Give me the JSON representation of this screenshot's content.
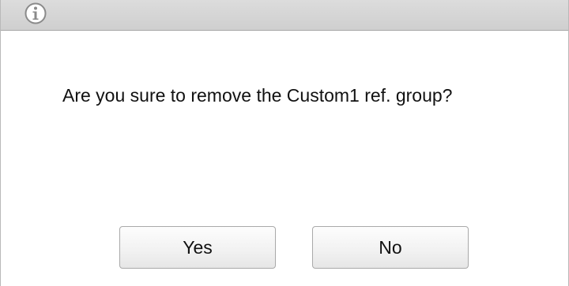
{
  "dialog": {
    "icon": "info-icon",
    "message": "Are you sure to remove the Custom1 ref. group?",
    "buttons": {
      "yes_label": "Yes",
      "no_label": "No"
    }
  },
  "colors": {
    "titlebar": "#d6d6d6",
    "background": "#ffffff",
    "text": "#111111",
    "button_border": "#a9a9a9"
  }
}
